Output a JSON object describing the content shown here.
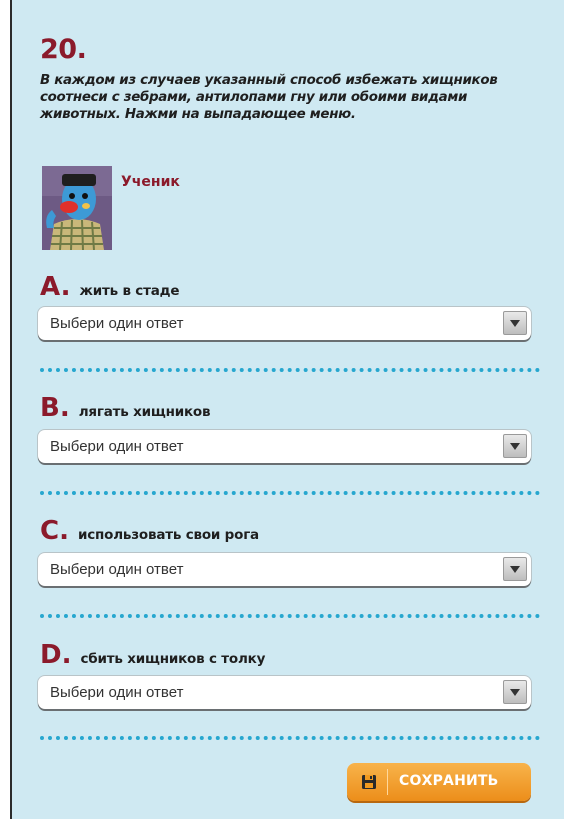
{
  "question": {
    "number": "20.",
    "instruction": "В каждом из случаев указанный способ избежать хищников соотнеси с зебрами, антилопами гну или обоими видами животных. Нажми на выпадающее меню."
  },
  "student": {
    "label": "Ученик"
  },
  "items": [
    {
      "letter": "A.",
      "text": "жить в стаде",
      "select_value": "Выбери один ответ"
    },
    {
      "letter": "B.",
      "text": "лягать хищников",
      "select_value": "Выбери один ответ"
    },
    {
      "letter": "C.",
      "text": "использовать свои рога",
      "select_value": "Выбери один ответ"
    },
    {
      "letter": "D.",
      "text": "сбить хищников с толку",
      "select_value": "Выбери один ответ"
    }
  ],
  "save_button": {
    "label": "СОХРАНИТЬ",
    "icon": "save-icon"
  },
  "colors": {
    "background": "#cfe9f2",
    "accent": "#8b1a2b",
    "separator": "#27a7cf",
    "button": "#f0991f"
  }
}
